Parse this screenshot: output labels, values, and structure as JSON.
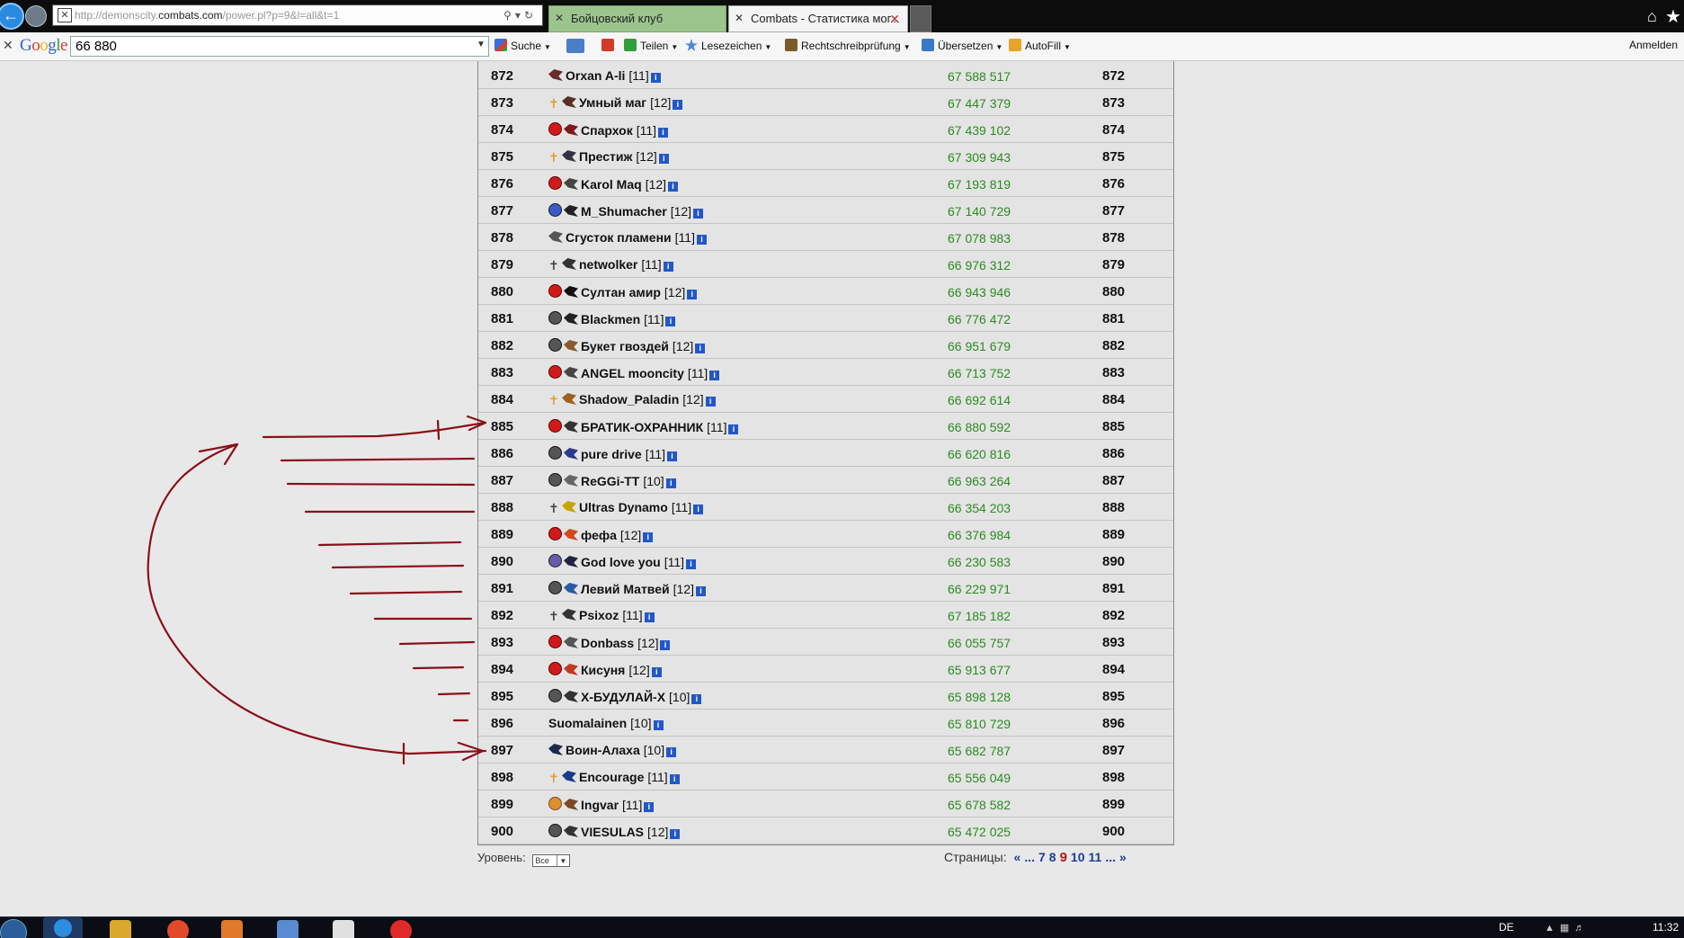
{
  "browser": {
    "url_prefix": "http://demonscity.",
    "url_host": "combats.com",
    "url_path": "/power.pl?p=9&l=all&t=1",
    "tabs": [
      {
        "label": "Бойцовский клуб"
      },
      {
        "label": "Combats - Статистика мог..."
      }
    ]
  },
  "toolbar": {
    "search_value": "66 880",
    "search_btn": "Suche",
    "teilen": "Teilen",
    "lesezeichen": "Lesezeichen",
    "rechtschreib": "Rechtschreibprüfung",
    "uebersetzen": "Übersetzen",
    "autofill": "AutoFill",
    "anmelden": "Anmelden"
  },
  "table": {
    "rows": [
      {
        "rank": "872",
        "name": "Orxan A-li",
        "level": "[11]",
        "power": "67 588 517",
        "align": "none",
        "clan": "#6b2a2a"
      },
      {
        "rank": "873",
        "name": "Умный маг",
        "level": "[12]",
        "power": "67 447 379",
        "align": "cross",
        "clan": "#553322"
      },
      {
        "rank": "874",
        "name": "Спархок",
        "level": "[11]",
        "power": "67 439 102",
        "align": "red",
        "clan": "#7a1a1a"
      },
      {
        "rank": "875",
        "name": "Престиж",
        "level": "[12]",
        "power": "67 309 943",
        "align": "cross",
        "clan": "#334"
      },
      {
        "rank": "876",
        "name": "Karol Maq",
        "level": "[12]",
        "power": "67 193 819",
        "align": "red",
        "clan": "#444"
      },
      {
        "rank": "877",
        "name": "M_Shumacher",
        "level": "[12]",
        "power": "67 140 729",
        "align": "blue",
        "clan": "#222"
      },
      {
        "rank": "878",
        "name": "Сгусток пламени",
        "level": "[11]",
        "power": "67 078 983",
        "align": "none",
        "clan": "#555"
      },
      {
        "rank": "879",
        "name": "netwolker",
        "level": "[11]",
        "power": "66 976 312",
        "align": "gray-cross",
        "clan": "#333"
      },
      {
        "rank": "880",
        "name": "Султан амир",
        "level": "[12]",
        "power": "66 943 946",
        "align": "red",
        "clan": "#111"
      },
      {
        "rank": "881",
        "name": "Blackmen",
        "level": "[11]",
        "power": "66 776 472",
        "align": "dark",
        "clan": "#222"
      },
      {
        "rank": "882",
        "name": "Букет гвоздей",
        "level": "[12]",
        "power": "66 951 679",
        "align": "dark",
        "clan": "#8a5a2a"
      },
      {
        "rank": "883",
        "name": "ANGEL mooncity",
        "level": "[11]",
        "power": "66 713 752",
        "align": "red",
        "clan": "#444"
      },
      {
        "rank": "884",
        "name": "Shadow_Paladin",
        "level": "[12]",
        "power": "66 692 614",
        "align": "cross",
        "clan": "#a06020"
      },
      {
        "rank": "885",
        "name": "БРАТИК-ОХРАННИК",
        "level": "[11]",
        "power": "66 880 592",
        "align": "red",
        "clan": "#333"
      },
      {
        "rank": "886",
        "name": "pure drive",
        "level": "[11]",
        "power": "66 620 816",
        "align": "dark",
        "clan": "#2a3a8a"
      },
      {
        "rank": "887",
        "name": "ReGGi-TT",
        "level": "[10]",
        "power": "66 963 264",
        "align": "dark",
        "clan": "#666"
      },
      {
        "rank": "888",
        "name": "Ultras Dynamo",
        "level": "[11]",
        "power": "66 354 203",
        "align": "gray-cross",
        "clan": "#c8a400"
      },
      {
        "rank": "889",
        "name": "фефа",
        "level": "[12]",
        "power": "66 376 984",
        "align": "red",
        "clan": "#d04a20"
      },
      {
        "rank": "890",
        "name": "God love you",
        "level": "[11]",
        "power": "66 230 583",
        "align": "purple",
        "clan": "#224"
      },
      {
        "rank": "891",
        "name": "Левий Матвей",
        "level": "[12]",
        "power": "66 229 971",
        "align": "dark",
        "clan": "#2a5aa0"
      },
      {
        "rank": "892",
        "name": "Psixoz",
        "level": "[11]",
        "power": "67 185 182",
        "align": "gray-cross",
        "clan": "#333"
      },
      {
        "rank": "893",
        "name": "Donbass",
        "level": "[12]",
        "power": "66 055 757",
        "align": "red",
        "clan": "#555"
      },
      {
        "rank": "894",
        "name": "Кисуня",
        "level": "[12]",
        "power": "65 913 677",
        "align": "red",
        "clan": "#c03a20"
      },
      {
        "rank": "895",
        "name": "Х-БУДУЛАЙ-Х",
        "level": "[10]",
        "power": "65 898 128",
        "align": "dark",
        "clan": "#333"
      },
      {
        "rank": "896",
        "name": "Suomalainen",
        "level": "[10]",
        "power": "65 810 729",
        "align": "none",
        "clan": "none"
      },
      {
        "rank": "897",
        "name": "Воин-Алаха",
        "level": "[10]",
        "power": "65 682 787",
        "align": "none",
        "clan": "#1a2a4a"
      },
      {
        "rank": "898",
        "name": "Encourage",
        "level": "[11]",
        "power": "65 556 049",
        "align": "cross",
        "clan": "#1a3a8a"
      },
      {
        "rank": "899",
        "name": "Ingvar",
        "level": "[11]",
        "power": "65 678 582",
        "align": "orange",
        "clan": "#7a4a2a"
      },
      {
        "rank": "900",
        "name": "VIESULAS",
        "level": "[12]",
        "power": "65 472 025",
        "align": "dark",
        "clan": "#333"
      }
    ]
  },
  "footer": {
    "level_label": "Уровень:",
    "level_value": "Все",
    "pages_label": "Страницы:",
    "pages": [
      "«",
      "...",
      "7",
      "8",
      "9",
      "10",
      "11",
      "...",
      "»"
    ],
    "current_page": "9"
  },
  "taskbar": {
    "lang": "DE",
    "clock": "11:32"
  },
  "colors": {
    "power_green": "#2b8a20",
    "annotation_red": "#8a0f1a",
    "link_blue": "#1a3e96",
    "current_page_red": "#b41a1a"
  }
}
